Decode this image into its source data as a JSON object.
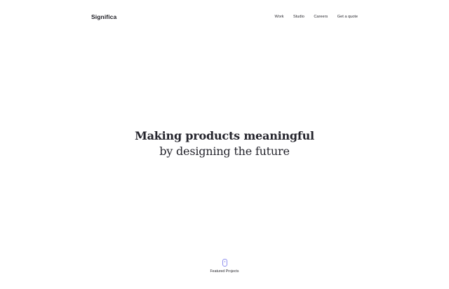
{
  "brand": {
    "name": "Significa"
  },
  "nav": {
    "items": [
      {
        "label": "Work"
      },
      {
        "label": "Studio"
      },
      {
        "label": "Careers"
      },
      {
        "label": "Get a quote"
      }
    ]
  },
  "hero": {
    "line1": "Making products meaningful",
    "line2": "by designing the future"
  },
  "scroll": {
    "label": "Featured Projects",
    "icon": "mouse-scroll-icon",
    "accent_color": "#8f8fef"
  }
}
